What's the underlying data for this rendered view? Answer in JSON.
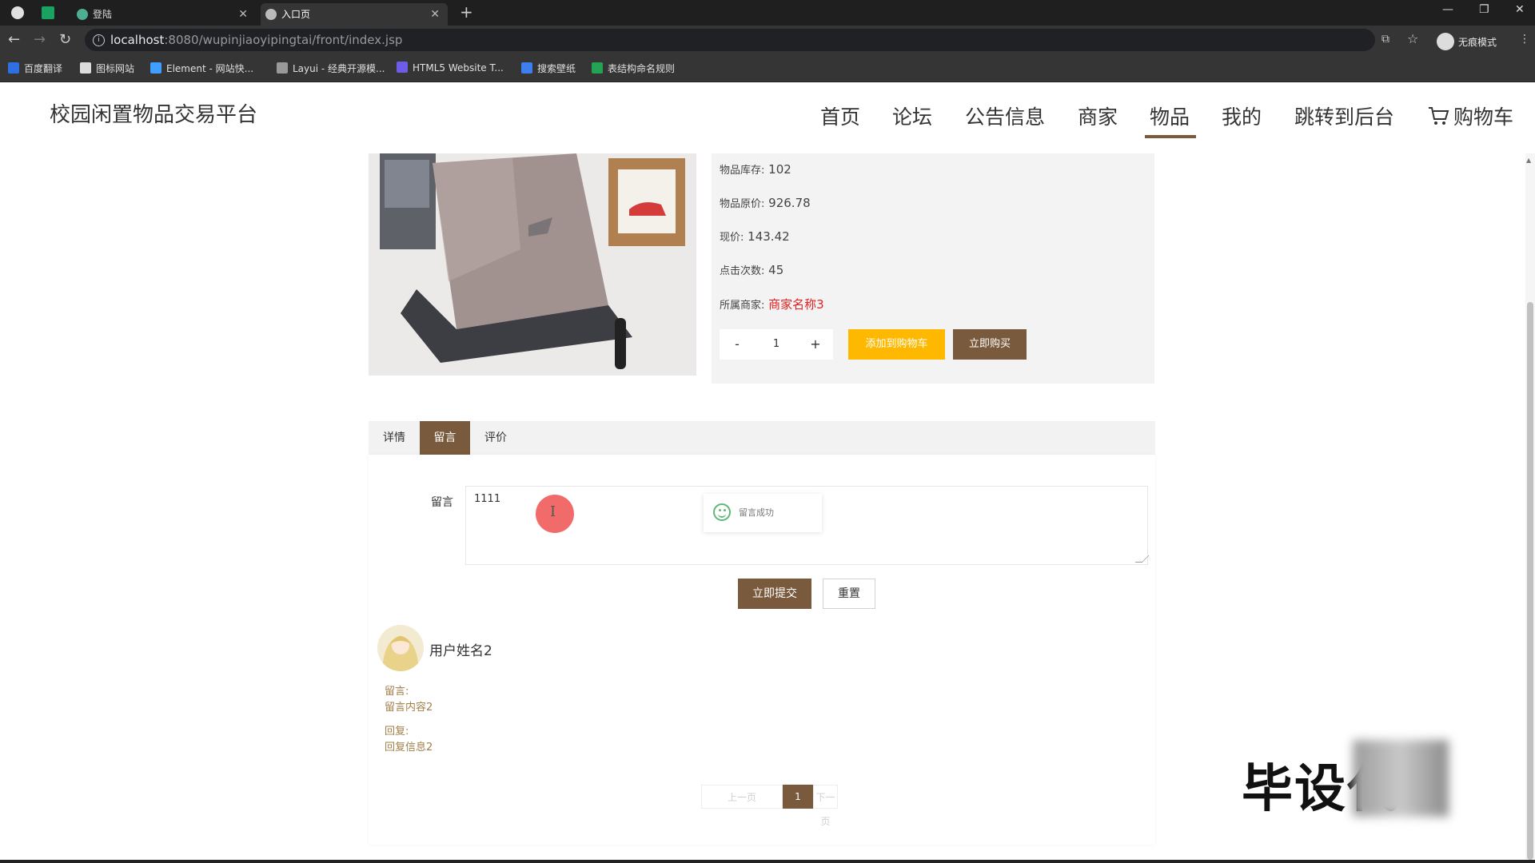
{
  "browser": {
    "tabs": [
      {
        "label": ""
      },
      {
        "label": ""
      },
      {
        "label": "登陆"
      },
      {
        "label": "入口页"
      }
    ],
    "url_host": "localhost",
    "url_path": ":8080/wupinjiaoyipingtai/front/index.jsp",
    "incognito_label": "无痕模式",
    "bookmarks": [
      {
        "label": "百度翻译",
        "color": "#2f6fe4"
      },
      {
        "label": "图标网站",
        "color": "#dddddd"
      },
      {
        "label": "Element - 网站快...",
        "color": "#409eff"
      },
      {
        "label": "Layui - 经典开源模...",
        "color": "#999999"
      },
      {
        "label": "HTML5 Website T...",
        "color": "#6c5ce7"
      },
      {
        "label": "搜索壁纸",
        "color": "#3d7ef0"
      },
      {
        "label": "表结构命名规则",
        "color": "#23a455"
      }
    ]
  },
  "site": {
    "title": "校园闲置物品交易平台",
    "nav": [
      {
        "label": "首页"
      },
      {
        "label": "论坛"
      },
      {
        "label": "公告信息"
      },
      {
        "label": "商家"
      },
      {
        "label": "物品",
        "active": true
      },
      {
        "label": "我的"
      },
      {
        "label": "跳转到后台"
      },
      {
        "label": "购物车"
      }
    ]
  },
  "product": {
    "stock_label": "物品库存:",
    "stock_value": "102",
    "original_price_label": "物品原价:",
    "original_price_value": "926.78",
    "current_price_label": "现价:",
    "current_price_value": "143.42",
    "clicks_label": "点击次数:",
    "clicks_value": "45",
    "seller_label": "所属商家:",
    "seller_value": "商家名称3",
    "quantity": "1",
    "minus_label": "-",
    "plus_label": "+",
    "add_cart_label": "添加到购物车",
    "buy_now_label": "立即购买"
  },
  "tabs": [
    {
      "label": "详情"
    },
    {
      "label": "留言",
      "active": true
    },
    {
      "label": "评价"
    }
  ],
  "message_form": {
    "label": "留言",
    "value": "1111",
    "toast": "留言成功",
    "submit_label": "立即提交",
    "reset_label": "重置"
  },
  "comments": [
    {
      "username": "用户姓名2",
      "message_label": "留言:",
      "message": "留言内容2",
      "reply_label": "回复:",
      "reply": "回复信息2"
    }
  ],
  "pagination": {
    "prev_label": "上一页",
    "current": "1",
    "next_label": "下一页"
  },
  "watermark": "毕设代"
}
